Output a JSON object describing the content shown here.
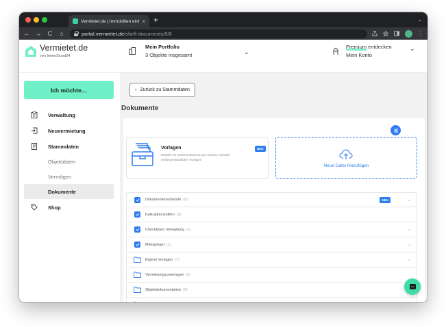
{
  "browser": {
    "tab_title": "Vermietet.de | Immobilien einfach",
    "tab_close": "×",
    "new_tab": "+",
    "url_host": "portal.vermietet.de",
    "url_path": "/shelf-documents/0/0",
    "nav": {
      "back": "←",
      "forward": "→",
      "reload": "C",
      "home": "⌂"
    },
    "menu": "⌄",
    "more": "⋮"
  },
  "header": {
    "logo": "Vermietet.de",
    "logo_sub": "von ImmoScout24",
    "portfolio_title": "Mein Portfolio",
    "portfolio_sub": "3 Objekte insgesamt",
    "account_premium": "Premium",
    "account_action": "entdecken",
    "account_label": "Mein Konto",
    "chevron": "⌄"
  },
  "sidebar": {
    "cta": "Ich möchte…",
    "items": [
      {
        "label": "Verwaltung",
        "icon": "clipboard-icon"
      },
      {
        "label": "Neuvermietung",
        "icon": "door-enter-icon"
      },
      {
        "label": "Stammdaten",
        "icon": "document-icon"
      },
      {
        "label": "Objektdaten",
        "icon": ""
      },
      {
        "label": "Vermögen",
        "icon": ""
      },
      {
        "label": "Dokumente",
        "icon": ""
      },
      {
        "label": "Shop",
        "icon": "tag-icon"
      }
    ]
  },
  "main": {
    "back_button": "Zurück zu Stammdaten",
    "title": "Dokumente",
    "vorlagen": {
      "title": "Vorlagen",
      "description": "Erstelle ein neues Dokument aus unserer Auswahl rechtsverständlicher Vorlagen",
      "badge": "NEU"
    },
    "upload_label": "Neue Datei hinzufügen",
    "folders": [
      {
        "label": "Dokumentenentwürfe",
        "count": "(0)",
        "type": "checkbox",
        "badge": "NEU",
        "chevron": "⌄"
      },
      {
        "label": "Kalkulationshilfen",
        "count": "(0)",
        "type": "checkbox",
        "badge": "",
        "chevron": ""
      },
      {
        "label": "Checklisten Verwaltung",
        "count": "(1)",
        "type": "checkbox",
        "badge": "",
        "chevron": "⌄"
      },
      {
        "label": "Mietspiegel",
        "count": "(1)",
        "type": "checkbox",
        "badge": "",
        "chevron": "⌄"
      },
      {
        "label": "Eigene Vorlagen",
        "count": "(1)",
        "type": "folder",
        "badge": "",
        "chevron": "⌄"
      },
      {
        "label": "Vermietungsunterlagen",
        "count": "(0)",
        "type": "folder",
        "badge": "",
        "chevron": ""
      },
      {
        "label": "Objektdokumentation",
        "count": "(0)",
        "type": "folder",
        "badge": "",
        "chevron": ""
      },
      {
        "label": "Buchhaltung",
        "count": "(0)",
        "type": "folder",
        "badge": "",
        "chevron": ""
      }
    ]
  },
  "colors": {
    "accent_mint": "#6ff0c6",
    "primary_blue": "#2f7cf0",
    "background": "#f2f2f2"
  }
}
